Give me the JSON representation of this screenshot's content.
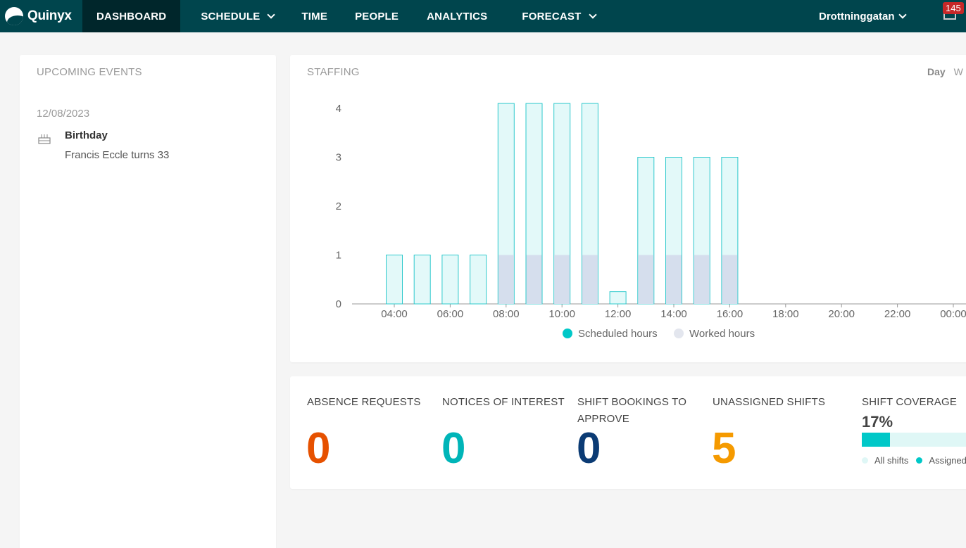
{
  "app": {
    "logo_text": "Quinyx"
  },
  "nav": {
    "items": [
      {
        "label": "DASHBOARD"
      },
      {
        "label": "SCHEDULE"
      },
      {
        "label": "TIME"
      },
      {
        "label": "PEOPLE"
      },
      {
        "label": "ANALYTICS"
      },
      {
        "label": "FORECAST"
      }
    ],
    "active": "DASHBOARD",
    "store": "Drottninggatan",
    "notification_count": "145"
  },
  "events": {
    "title": "UPCOMING EVENTS",
    "date": "12/08/2023",
    "item_title": "Birthday",
    "item_desc": "Francis Eccle turns 33",
    "icon": "birthday-cake-icon"
  },
  "staffing": {
    "title": "STAFFING",
    "period_selected": "Day",
    "period_next": "W"
  },
  "chart_data": {
    "type": "bar",
    "x_ticks": [
      "04:00",
      "06:00",
      "08:00",
      "10:00",
      "12:00",
      "14:00",
      "16:00",
      "18:00",
      "20:00",
      "22:00",
      "00:00"
    ],
    "y_ticks": [
      0,
      1,
      2,
      3,
      4
    ],
    "ylim": [
      0,
      4
    ],
    "hours": [
      "04:00",
      "05:00",
      "06:00",
      "07:00",
      "08:00",
      "09:00",
      "10:00",
      "11:00",
      "12:00",
      "13:00",
      "14:00",
      "15:00",
      "16:00"
    ],
    "series": [
      {
        "name": "Scheduled hours",
        "color": "#00c8c8",
        "values": [
          1,
          1,
          1,
          1,
          4.1,
          4.1,
          4.1,
          4.1,
          0.25,
          3,
          3,
          3,
          3
        ]
      },
      {
        "name": "Worked hours",
        "color": "#e3e6ee",
        "values": [
          0,
          0,
          0,
          0,
          1,
          1,
          1,
          1,
          0,
          1,
          1,
          1,
          1
        ]
      }
    ],
    "legend": "bottom",
    "grid": false
  },
  "stats": {
    "absence": {
      "label": "ABSENCE REQUESTS",
      "value": "0",
      "color": "#e65100"
    },
    "notices": {
      "label": "NOTICES OF INTEREST",
      "value": "0",
      "color": "#00b5b8"
    },
    "bookings": {
      "label_1": "SHIFT BOOKINGS TO",
      "label_2": "APPROVE",
      "value": "0",
      "color": "#0b3b74"
    },
    "unassigned": {
      "label": "UNASSIGNED SHIFTS",
      "value": "5",
      "color": "#f59a00"
    },
    "coverage": {
      "label": "SHIFT COVERAGE",
      "pct": "17%",
      "fraction": 0.245,
      "legend_all": "All shifts",
      "legend_assigned": "Assigned"
    }
  }
}
